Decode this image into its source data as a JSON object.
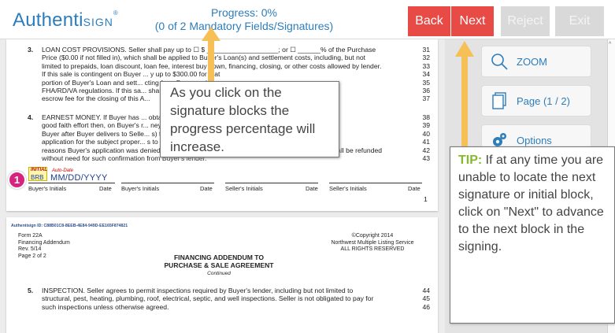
{
  "header": {
    "logo_main": "Authenti",
    "logo_sign": "SIGN",
    "logo_tm": "®",
    "progress_line1": "Progress: 0%",
    "progress_line2": "(0 of 2 Mandatory Fields/Signatures)",
    "buttons": {
      "back": "Back",
      "next": "Next",
      "reject": "Reject",
      "exit": "Exit"
    }
  },
  "colors": {
    "accent": "#2d7dbb",
    "primary_button": "#e84a45",
    "disabled_button": "#d9d9d9",
    "tip_highlight": "#86b92f",
    "marker": "#d8237e",
    "callout_arrow": "#f6c056"
  },
  "page1": {
    "sec3_num": "3.",
    "sec3_lines": [
      "LOAN COST PROVISIONS. Seller shall pay up to ☐ $ ___________________; or ☐ ______% of the Purchase",
      "Price ($0.00 if not filled in), which shall be applied to Buyer's Loan(s) and settlement costs, including, but not",
      "limited to prepaids, loan discount, loan fee, interest buy down, financing, closing, or other costs allowed by lender.",
      "If this sale is contingent on Buyer ... y up to $300.00 for that",
      "portion of Buyer's Loan and sett... cting from Buyer under",
      "FHA/RD/VA regulations. If this sa... shall also pay the full",
      "escrow fee for the closing of this A..."
    ],
    "sec3_linenums": [
      "31",
      "32",
      "33",
      "34",
      "35",
      "36",
      "37"
    ],
    "sec4_num": "4.",
    "sec4_lines": [
      "EARNEST MONEY. If Buyer has ... obtain financing after a",
      "good faith effort then, on Buyer's r... ney shall be refunded to",
      "Buyer after Buyer delivers to Selle... s) the date Buyer's loan",
      "application for the subject proper... s to close; and (c) the",
      "reasons Buyer's application was denied. If Seller terminates this Agreement, the Earnest Money shall be refunded",
      "without need for such confirmation from Buyer's lender."
    ],
    "sec4_linenums": [
      "38",
      "39",
      "40",
      "41",
      "42",
      "43"
    ],
    "initial_tag": "INITIAL",
    "initial_value": "BRB",
    "auto_date_tag": "Auto-Date",
    "date_value": "MM/DD/YYYY",
    "sig_labels": [
      "Buyer's Initials",
      "Date",
      "Buyer's Initials",
      "Date",
      "Seller's Initials",
      "Date",
      "Seller's Initials",
      "Date"
    ],
    "page_number": "1"
  },
  "page2": {
    "doc_id": "Authentisign ID: C88B01C8-8EEB-4E84-949D-EE165F874821",
    "form_lines": [
      "Form 22A",
      "Financing Addendum",
      "Rev. 5/14",
      "Page 2 of 2"
    ],
    "copyright_lines": [
      "©Copyright 2014",
      "Northwest Multiple Listing Service",
      "ALL RIGHTS RESERVED"
    ],
    "title1": "FINANCING ADDENDUM TO",
    "title2": "PURCHASE & SALE AGREEMENT",
    "subtitle": "Continued",
    "sec5_num": "5.",
    "sec5_lines": [
      "INSPECTION. Seller agrees to permit inspections required by Buyer's lender, including but not limited to",
      "structural, pest, heating, plumbing, roof, electrical, septic, and well inspections. Seller is not obligated to pay for",
      "such inspections unless otherwise agreed."
    ],
    "sec5_linenums": [
      "44",
      "45",
      "46"
    ]
  },
  "marker_label": "1",
  "tooltip_progress": "As you click on the signature blocks the progress percentage will increase.",
  "sidebar": {
    "zoom_label": "ZOOM",
    "page_label": "Page (1 / 2)",
    "options_label": "Options"
  },
  "tip": {
    "label": "TIP:",
    "text": " If at any time you are unable to locate the next signature or initial block, click on \"Next\" to advance to the next block in the signing."
  },
  "icons": [
    "search-icon",
    "page-icon",
    "gear-icon",
    "scroll-up-icon"
  ]
}
